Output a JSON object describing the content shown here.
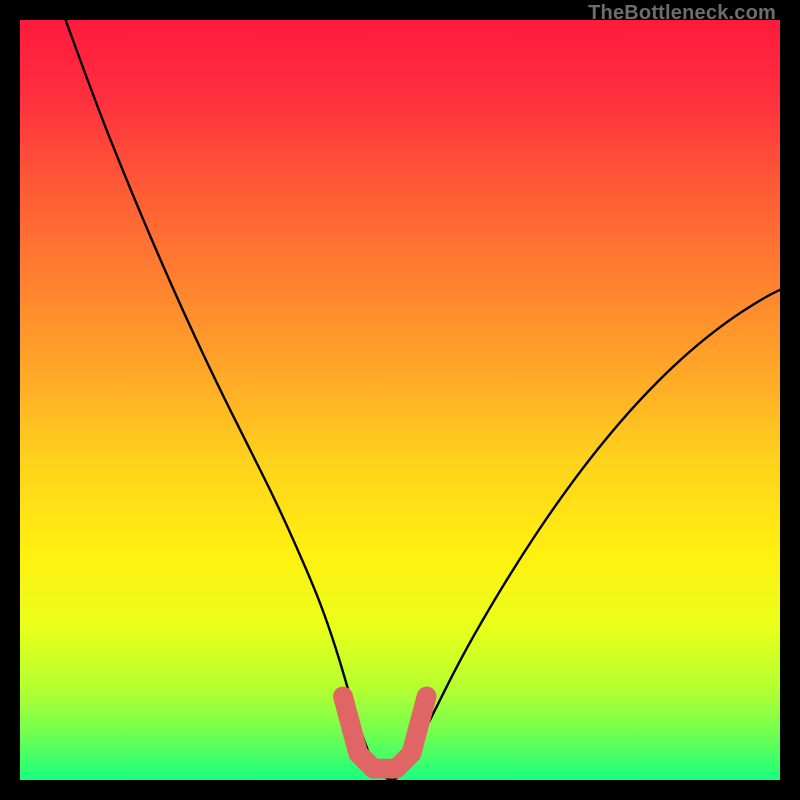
{
  "watermark": "TheBottleneck.com",
  "chart_data": {
    "type": "line",
    "title": "",
    "xlabel": "",
    "ylabel": "",
    "xlim": [
      0,
      100
    ],
    "ylim": [
      0,
      100
    ],
    "series": [
      {
        "name": "bottleneck-curve",
        "x": [
          6,
          10,
          14,
          18,
          22,
          26,
          30,
          34,
          38,
          40,
          42,
          44,
          46,
          48,
          50,
          54,
          58,
          62,
          66,
          70,
          74,
          78,
          82,
          86,
          90,
          94,
          98,
          100
        ],
        "y": [
          100,
          89,
          79,
          69.5,
          60.5,
          52,
          44,
          36,
          27,
          22,
          16,
          9,
          3,
          0,
          0,
          8,
          16,
          23,
          29.5,
          35.5,
          41,
          46,
          50.5,
          54.5,
          58,
          61,
          63.5,
          64.5
        ]
      }
    ],
    "annotations": [
      {
        "name": "optimal-segment",
        "type": "polyline",
        "x": [
          42.5,
          44.5,
          46.5,
          49.5,
          51.5,
          53.5
        ],
        "y": [
          11,
          3.5,
          1.5,
          1.5,
          3.5,
          11
        ]
      }
    ],
    "gradient_stops": [
      {
        "offset": 0.0,
        "color": "#ff1a3c"
      },
      {
        "offset": 0.1,
        "color": "#ff2f3e"
      },
      {
        "offset": 0.22,
        "color": "#ff5a36"
      },
      {
        "offset": 0.34,
        "color": "#ff8030"
      },
      {
        "offset": 0.46,
        "color": "#ffa628"
      },
      {
        "offset": 0.58,
        "color": "#ffd21c"
      },
      {
        "offset": 0.7,
        "color": "#fff010"
      },
      {
        "offset": 0.8,
        "color": "#e8ff1a"
      },
      {
        "offset": 0.88,
        "color": "#b4ff30"
      },
      {
        "offset": 0.94,
        "color": "#70ff50"
      },
      {
        "offset": 1.0,
        "color": "#18ff80"
      }
    ],
    "highlight_color": "#e06666",
    "highlight_width_pct": 2.6
  }
}
